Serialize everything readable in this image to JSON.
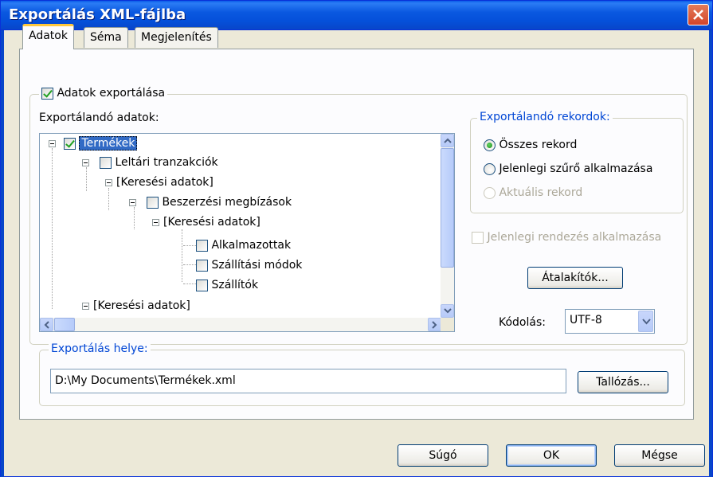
{
  "window": {
    "title": "Exportálás XML-fájlba"
  },
  "tabs": [
    {
      "label": "Adatok",
      "active": true
    },
    {
      "label": "Séma",
      "active": false
    },
    {
      "label": "Megjelenítés",
      "active": false
    }
  ],
  "export_data": {
    "checkbox_label": "Adatok exportálása",
    "checked": true,
    "tree_label": "Exportálandó adatok:",
    "tree": [
      {
        "label": "Termékek",
        "checked": true,
        "selected": true
      },
      {
        "label": "Leltári tranzakciók",
        "checked": false
      },
      {
        "label": "[Keresési adatok]"
      },
      {
        "label": "Beszerzési megbízások",
        "checked": false
      },
      {
        "label": "[Keresési adatok]"
      },
      {
        "label": "Alkalmazottak",
        "checked": false
      },
      {
        "label": "Szállítási módok",
        "checked": false
      },
      {
        "label": "Szállítók",
        "checked": false
      },
      {
        "label": "[Keresési adatok]"
      }
    ]
  },
  "records": {
    "legend": "Exportálandó rekordok:",
    "options": [
      {
        "label": "Összes rekord",
        "checked": true,
        "enabled": true
      },
      {
        "label": "Jelenlegi szűrő alkalmazása",
        "checked": false,
        "enabled": true
      },
      {
        "label": "Aktuális rekord",
        "checked": false,
        "enabled": false
      }
    ]
  },
  "sort": {
    "label": "Jelenlegi rendezés alkalmazása",
    "checked": false,
    "enabled": false
  },
  "transforms_button": "Átalakítók...",
  "encoding": {
    "label": "Kódolás:",
    "value": "UTF-8"
  },
  "location": {
    "legend": "Exportálás helye:",
    "path": "D:\\My Documents\\Termékek.xml",
    "browse_button": "Tallózás..."
  },
  "footer": {
    "help": "Súgó",
    "ok": "OK",
    "cancel": "Mégse"
  },
  "colors": {
    "titlebar": "#0A58E0",
    "selection": "#316AC5",
    "legend_blue": "#0046D5",
    "focus_tab": "#FFC83C"
  }
}
